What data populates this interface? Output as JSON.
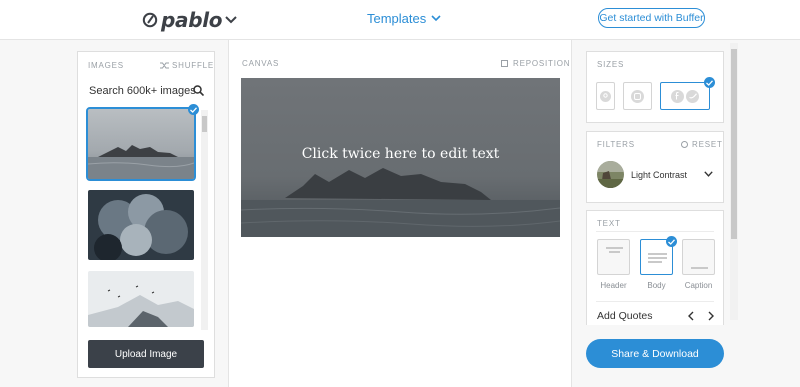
{
  "header": {
    "logo_text": "pablo",
    "templates_label": "Templates",
    "cta_label": "Get started with Buffer"
  },
  "images_panel": {
    "title": "IMAGES",
    "shuffle_label": "SHUFFLE",
    "search_placeholder": "Search 600k+ images",
    "upload_label": "Upload Image"
  },
  "canvas": {
    "title": "CANVAS",
    "reposition_label": "REPOSITION",
    "text": "Click twice here to edit text"
  },
  "sizes": {
    "title": "SIZES"
  },
  "filters": {
    "title": "FILTERS",
    "reset_label": "RESET",
    "selected": "Light Contrast"
  },
  "text_panel": {
    "title": "TEXT",
    "styles": [
      "Header",
      "Body",
      "Caption"
    ],
    "add_quotes_label": "Add Quotes"
  },
  "share_label": "Share & Download",
  "colors": {
    "accent": "#2c8ed6",
    "dark": "#3b4149"
  }
}
